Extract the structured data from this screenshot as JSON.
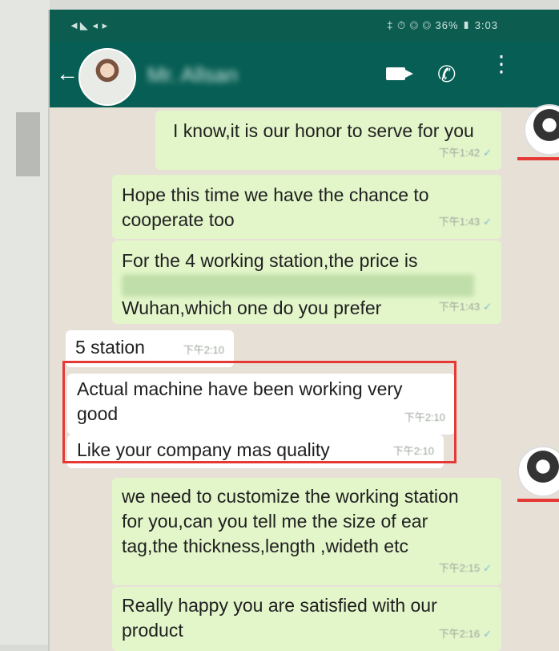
{
  "status_bar": {
    "left": "◄◣ ◂ ▸",
    "right": "‡ ⏱ ◎ ◎ 36% ▮ 3:03"
  },
  "header": {
    "contact_name": "Mr. Allsan"
  },
  "messages": [
    {
      "id": "m1",
      "direction": "out",
      "lines": [
        "I know,it is our honor to serve for you"
      ],
      "time": "下午1:42"
    },
    {
      "id": "m2",
      "direction": "out",
      "lines": [
        "Hope this time we have the chance to",
        "cooperate too"
      ],
      "time": "下午1:43"
    },
    {
      "id": "m3",
      "direction": "out",
      "lines": [
        "For the 4 working station,the price is",
        "Wuhan,which one do you prefer"
      ],
      "time": "下午1:43"
    },
    {
      "id": "m4",
      "direction": "in",
      "lines": [
        "5 station"
      ],
      "time": "下午2:10"
    },
    {
      "id": "m5",
      "direction": "in",
      "lines": [
        "Actual machine have been working very",
        "good"
      ],
      "time": "下午2:10"
    },
    {
      "id": "m6",
      "direction": "in",
      "lines": [
        "Like your company mas quality"
      ],
      "time": "下午2:10"
    },
    {
      "id": "m7",
      "direction": "out",
      "lines": [
        "we need to customize the working station",
        "for you,can you tell me the size of ear",
        "tag,the  thickness,length ,wideth etc"
      ],
      "time": "下午2:15"
    },
    {
      "id": "m8",
      "direction": "out",
      "lines": [
        "Really happy you are satisfied with our",
        "product"
      ],
      "time": "下午2:16"
    }
  ],
  "colors": {
    "header": "#075e54",
    "outgoing": "#e3f6ca",
    "incoming": "#ffffff",
    "highlight": "#e53935"
  }
}
